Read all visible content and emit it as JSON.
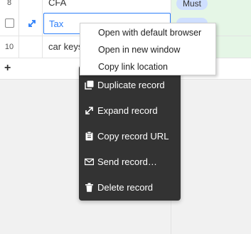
{
  "grid": {
    "rows": [
      {
        "number": "8",
        "value": "CFA",
        "tag": "Must"
      },
      {
        "number": "",
        "value": "Tax",
        "tag": ""
      },
      {
        "number": "10",
        "value": "car keys",
        "tag": ""
      }
    ],
    "add_row_label": "+"
  },
  "record_menu": {
    "items": [
      {
        "label": "Duplicate record",
        "icon": "duplicate-icon"
      },
      {
        "label": "Expand record",
        "icon": "expand-icon"
      },
      {
        "label": "Copy record URL",
        "icon": "clipboard-icon"
      },
      {
        "label": "Send record…",
        "icon": "envelope-icon"
      },
      {
        "label": "Delete record",
        "icon": "trash-icon"
      }
    ]
  },
  "browser_context_menu": {
    "items": [
      {
        "label": "Open with default browser"
      },
      {
        "label": "Open in new window"
      },
      {
        "label": "Copy link location"
      }
    ]
  },
  "colors": {
    "accent": "#2d7ff9",
    "tag_bg": "#cfdfff",
    "green_column": "#e5f6e6",
    "menu_bg": "#333333"
  }
}
